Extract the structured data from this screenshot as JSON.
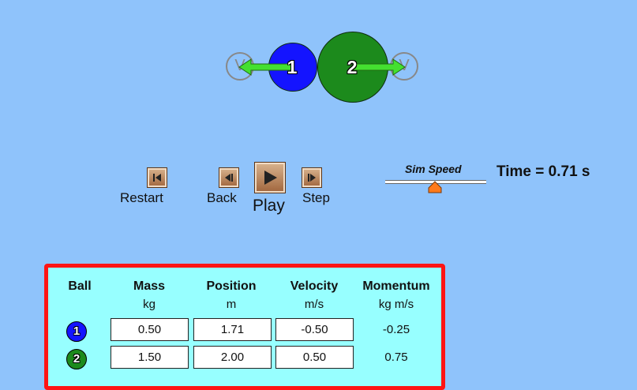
{
  "balls": [
    {
      "label": "1",
      "color": "#1414ff",
      "arrow_color": "#44e030"
    },
    {
      "label": "2",
      "color": "#1c8a1c",
      "arrow_color": "#44e030"
    }
  ],
  "velocity_marker_text": "V",
  "controls": {
    "restart": "Restart",
    "back": "Back",
    "play": "Play",
    "step": "Step"
  },
  "sim_speed": {
    "title": "Sim Speed",
    "level": 0.5
  },
  "time_readout": "Time = 0.71 s",
  "table": {
    "headers": [
      "Ball",
      "Mass",
      "Position",
      "Velocity",
      "Momentum"
    ],
    "units": [
      "",
      "kg",
      "m",
      "m/s",
      "kg m/s"
    ],
    "rows": [
      {
        "ball": "1",
        "mass": "0.50",
        "position": "1.71",
        "velocity": "-0.50",
        "momentum": "-0.25"
      },
      {
        "ball": "2",
        "mass": "1.50",
        "position": "2.00",
        "velocity": "0.50",
        "momentum": "0.75"
      }
    ]
  },
  "colors": {
    "background": "#8fc3fb",
    "panel": "#97ffff",
    "panel_border": "#ff1414"
  }
}
